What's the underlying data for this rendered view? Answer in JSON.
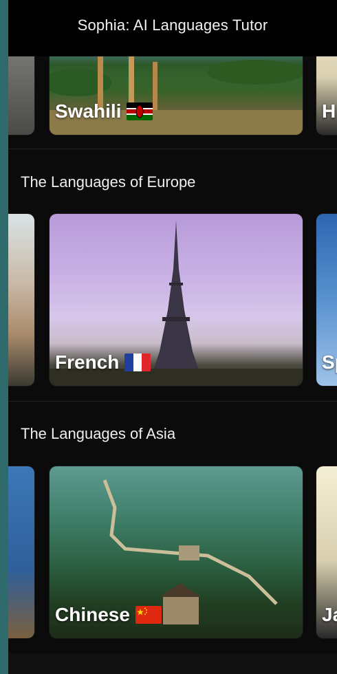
{
  "header": {
    "title": "Sophia: AI Languages Tutor"
  },
  "sections": [
    {
      "title": "The Languages of Europe"
    },
    {
      "title": "The Languages of Asia"
    }
  ],
  "cards": {
    "row1": {
      "left_partial": "",
      "main": {
        "label": "Swahili",
        "flag": "kenya-flag-icon"
      },
      "right_partial": "H"
    },
    "row2": {
      "left_partial": "",
      "main": {
        "label": "French",
        "flag": "france-flag-icon"
      },
      "right_partial": "Sp"
    },
    "row3": {
      "left_partial": "",
      "main": {
        "label": "Chinese",
        "flag": "china-flag-icon"
      },
      "right_partial": "Ja"
    }
  },
  "colors": {
    "accent_bg": "#2f6a6c",
    "app_bg": "#0b0b0b",
    "topbar_bg": "#000000"
  }
}
